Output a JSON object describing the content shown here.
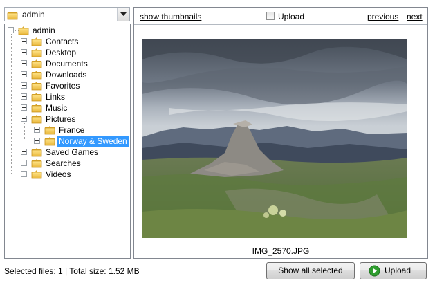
{
  "folder_dropdown": {
    "value": "admin",
    "folder_icon": "folder-icon",
    "arrow_icon": "chevron-down-icon"
  },
  "tree": {
    "root": "admin",
    "items": [
      {
        "label": "Contacts"
      },
      {
        "label": "Desktop"
      },
      {
        "label": "Documents"
      },
      {
        "label": "Downloads"
      },
      {
        "label": "Favorites"
      },
      {
        "label": "Links"
      },
      {
        "label": "Music"
      },
      {
        "label": "Pictures"
      },
      {
        "label": "France"
      },
      {
        "label": "Norway & Sweden"
      },
      {
        "label": "Saved Games"
      },
      {
        "label": "Searches"
      },
      {
        "label": "Videos"
      }
    ]
  },
  "viewer": {
    "show_thumbnails": "show thumbnails",
    "upload_checkbox_label": "Upload",
    "previous": "previous",
    "next": "next",
    "filename": "IMG_2570.JPG"
  },
  "footer": {
    "status": "Selected files: 1 | Total size: 1.52 MB",
    "show_all_selected": "Show all selected",
    "upload": "Upload"
  },
  "colors": {
    "selection": "#3399ff",
    "upload_icon": "#2e9d2e"
  }
}
